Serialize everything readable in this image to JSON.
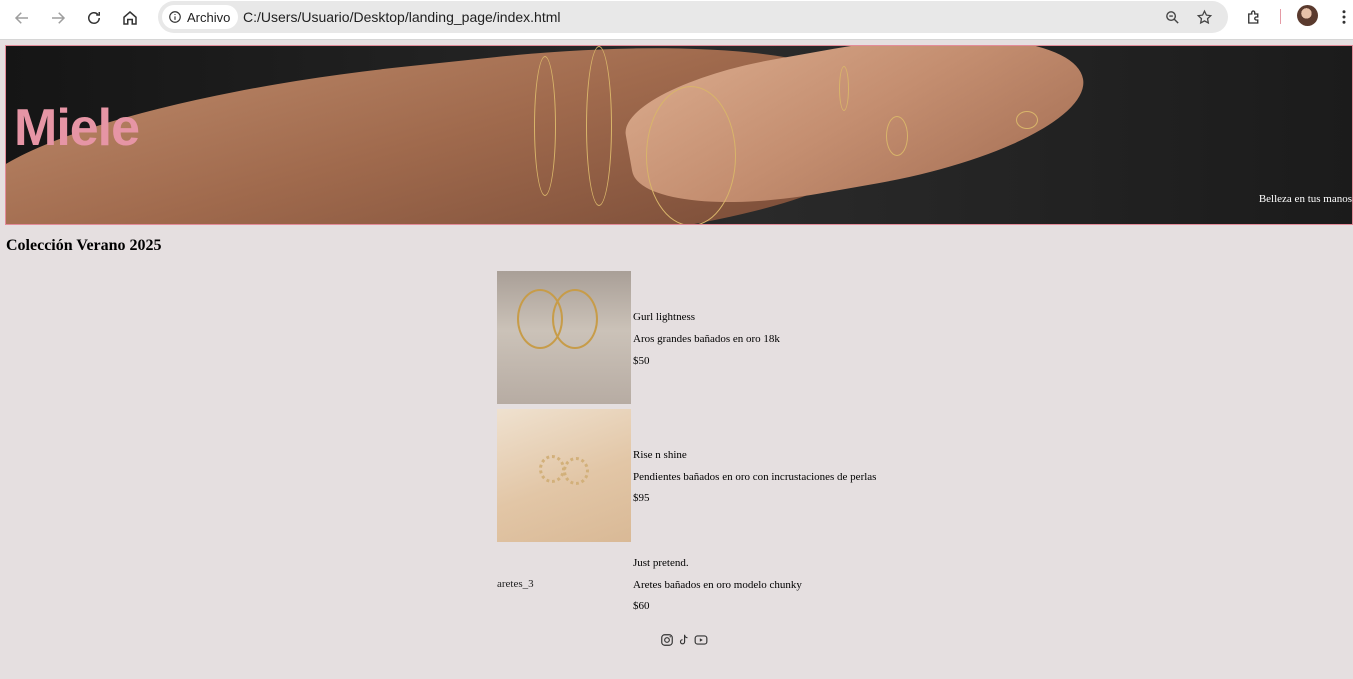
{
  "browser": {
    "site_chip_label": "Archivo",
    "url": "C:/Users/Usuario/Desktop/landing_page/index.html"
  },
  "header": {
    "brand": "Miele",
    "tagline": "Belleza en tus manos"
  },
  "collection": {
    "title": "Colección Verano 2025",
    "products": [
      {
        "name": "Gurl lightness",
        "description": "Aros grandes bañados en oro 18k",
        "price": "$50"
      },
      {
        "name": "Rise n shine",
        "description": "Pendientes bañados en oro con incrustaciones de perlas",
        "price": "$95"
      },
      {
        "name": "Just pretend.",
        "description": "Aretes bañados en oro modelo chunky",
        "price": "$60",
        "image_alt": "aretes_3"
      }
    ]
  },
  "footer": {
    "socials": [
      "instagram-icon",
      "tiktok-icon",
      "youtube-icon"
    ]
  },
  "colors": {
    "page_background": "#e5dfe0",
    "brand_pink": "#e695a5",
    "banner_border": "#e38b99"
  }
}
